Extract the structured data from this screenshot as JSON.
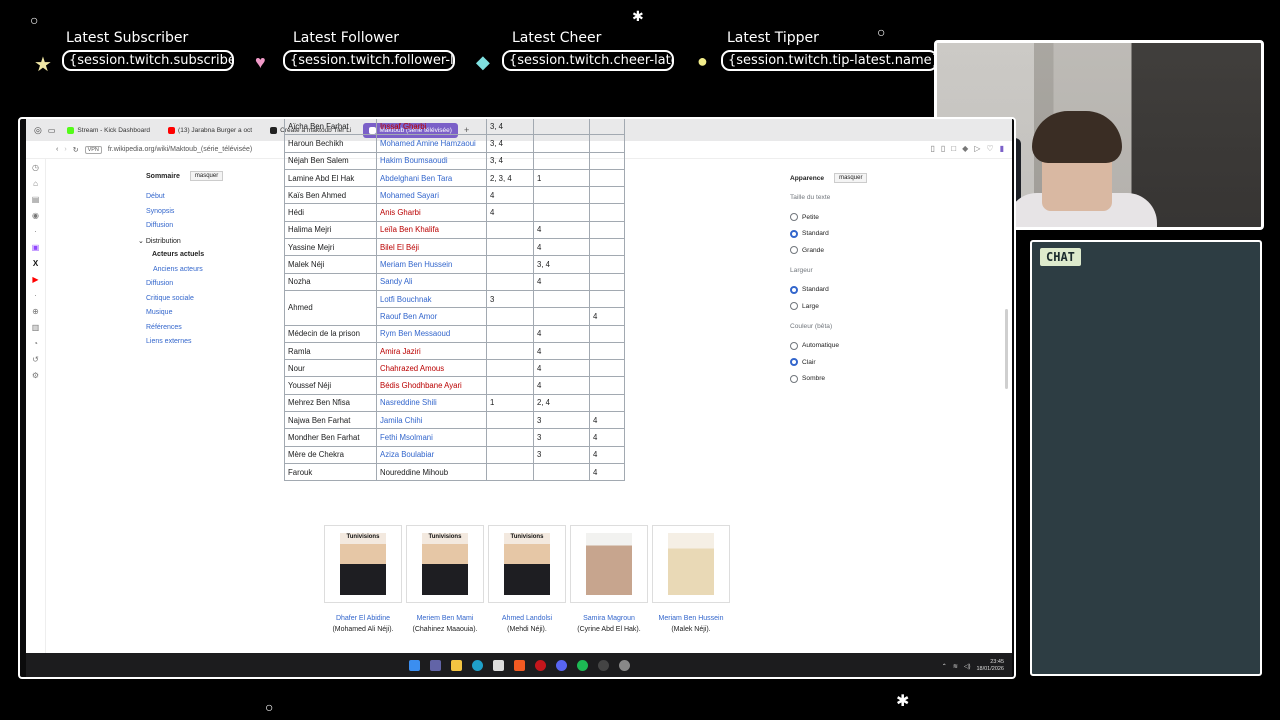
{
  "overlay": {
    "alerts": [
      {
        "heading": "Latest Subscriber",
        "value": "{session.twitch.subscriber-latest.name}"
      },
      {
        "heading": "Latest Follower",
        "value": "{session.twitch.follower-latest.name}"
      },
      {
        "heading": "Latest Cheer",
        "value": "{session.twitch.cheer-latest.name}"
      },
      {
        "heading": "Latest Tipper",
        "value": "{session.twitch.tip-latest.name}"
      }
    ],
    "chat_label": "CHAT"
  },
  "browser": {
    "tabs": [
      {
        "label": "Stream - Kick Dashboard",
        "color": "#53fc18"
      },
      {
        "label": "(13) Jarabna Burger a oct",
        "color": "#ff0000"
      },
      {
        "label": "Create a maktoub Tier Li",
        "color": "#222222"
      },
      {
        "label": "Maktoub (série télévisée)",
        "color": "#ffffff",
        "active": true
      }
    ],
    "badge": "VPN",
    "url": "fr.wikipedia.org/wiki/Maktoub_(série_télévisée)"
  },
  "toc": {
    "title": "Sommaire",
    "hide": "masquer",
    "items": [
      "Début",
      "Synopsis",
      "Diffusion"
    ],
    "distribution": "Distribution",
    "sub": [
      "Acteurs actuels",
      "Anciens acteurs"
    ],
    "after": [
      "Diffusion",
      "Critique sociale",
      "Musique",
      "Références",
      "Liens externes"
    ]
  },
  "cast_table": {
    "rows": [
      {
        "role": "Aïcha Ben Farhat",
        "actor": "Inssaf Gharbi",
        "link": "red",
        "s1": "3, 4",
        "s2": "",
        "s3": ""
      },
      {
        "role": "Haroun Bechikh",
        "actor": "Mohamed Amine Hamzaoui",
        "link": "blue",
        "s1": "3, 4",
        "s2": "",
        "s3": ""
      },
      {
        "role": "Néjah Ben Salem",
        "actor": "Hakim Boumsaoudi",
        "link": "blue",
        "s1": "3, 4",
        "s2": "",
        "s3": ""
      },
      {
        "role": "Lamine Abd El Hak",
        "actor": "Abdelghani Ben Tara",
        "link": "blue",
        "s1": "2, 3, 4",
        "s2": "1",
        "s3": ""
      },
      {
        "role": "Kaïs Ben Ahmed",
        "actor": "Mohamed Sayari",
        "link": "blue",
        "s1": "4",
        "s2": "",
        "s3": ""
      },
      {
        "role": "Hédi",
        "actor": "Anis Gharbi",
        "link": "red",
        "s1": "4",
        "s2": "",
        "s3": ""
      },
      {
        "role": "Halima Mejri",
        "actor": "Leïla Ben Khalifa",
        "link": "red",
        "s1": "",
        "s2": "4",
        "s3": ""
      },
      {
        "role": "Yassine Mejri",
        "actor": "Bilel El Béji",
        "link": "red",
        "s1": "",
        "s2": "4",
        "s3": ""
      },
      {
        "role": "Malek Néji",
        "actor": "Meriam Ben Hussein",
        "link": "blue",
        "s1": "",
        "s2": "3, 4",
        "s3": ""
      },
      {
        "role": "Nozha",
        "actor": "Sandy Ali",
        "link": "blue",
        "s1": "",
        "s2": "4",
        "s3": ""
      },
      {
        "role": "Ahmed",
        "actor": "Lotfi Bouchnak",
        "link": "blue",
        "s1": "3",
        "s2": "",
        "s3": ""
      },
      {
        "role": "",
        "actor": "Raouf Ben Amor",
        "link": "blue",
        "s1": "",
        "s2": "",
        "s3": "4"
      },
      {
        "role": "Médecin de la prison",
        "actor": "Rym Ben Messaoud",
        "link": "blue",
        "s1": "",
        "s2": "4",
        "s3": ""
      },
      {
        "role": "Ramla",
        "actor": "Amira Jaziri",
        "link": "red",
        "s1": "",
        "s2": "4",
        "s3": ""
      },
      {
        "role": "Nour",
        "actor": "Chahrazed Amous",
        "link": "red",
        "s1": "",
        "s2": "4",
        "s3": ""
      },
      {
        "role": "Youssef Néji",
        "actor": "Bédis Ghodhbane Ayari",
        "link": "red",
        "s1": "",
        "s2": "4",
        "s3": ""
      },
      {
        "role": "Mehrez Ben Nfisa",
        "actor": "Nasreddine Shili",
        "link": "blue",
        "s1": "1",
        "s2": "2, 4",
        "s3": ""
      },
      {
        "role": "Najwa Ben Farhat",
        "actor": "Jamila Chihi",
        "link": "blue",
        "s1": "",
        "s2": "3",
        "s3": "4"
      },
      {
        "role": "Mondher Ben Farhat",
        "actor": "Fethi Msolmani",
        "link": "blue",
        "s1": "",
        "s2": "3",
        "s3": "4"
      },
      {
        "role": "Mère de Chekra",
        "actor": "Aziza Boulabiar",
        "link": "blue",
        "s1": "",
        "s2": "3",
        "s3": "4"
      },
      {
        "role": "Farouk",
        "actor": "Noureddine Mihoub",
        "link": "black",
        "s1": "",
        "s2": "",
        "s3": "4"
      }
    ]
  },
  "gallery": [
    {
      "name": "Dhafer El Abidine",
      "role": "(Mohamed Ali Néji).",
      "mast": "Tunivisions"
    },
    {
      "name": "Meriem Ben Mami",
      "role": "(Chahinez Maaouia).",
      "mast": "Tunivisions"
    },
    {
      "name": "Ahmed Landolsi",
      "role": "(Mehdi Néji).",
      "mast": "Tunivisions"
    },
    {
      "name": "Samira Magroun",
      "role": "(Cyrine Abd El Hak).",
      "mast": ""
    },
    {
      "name": "Meriam Ben Hussein",
      "role": "(Malek Néji).",
      "mast": ""
    }
  ],
  "prefs": {
    "title": "Apparence",
    "hide": "masquer",
    "text_size": "Taille du texte",
    "text_opts": [
      "Petite",
      "Standard",
      "Grande"
    ],
    "width": "Largeur",
    "width_opts": [
      "Standard",
      "Large"
    ],
    "color": "Couleur (bêta)",
    "color_opts": [
      "Automatique",
      "Clair",
      "Sombre"
    ]
  },
  "taskbar": {
    "time": "23:45",
    "date": "18/01/2026"
  }
}
